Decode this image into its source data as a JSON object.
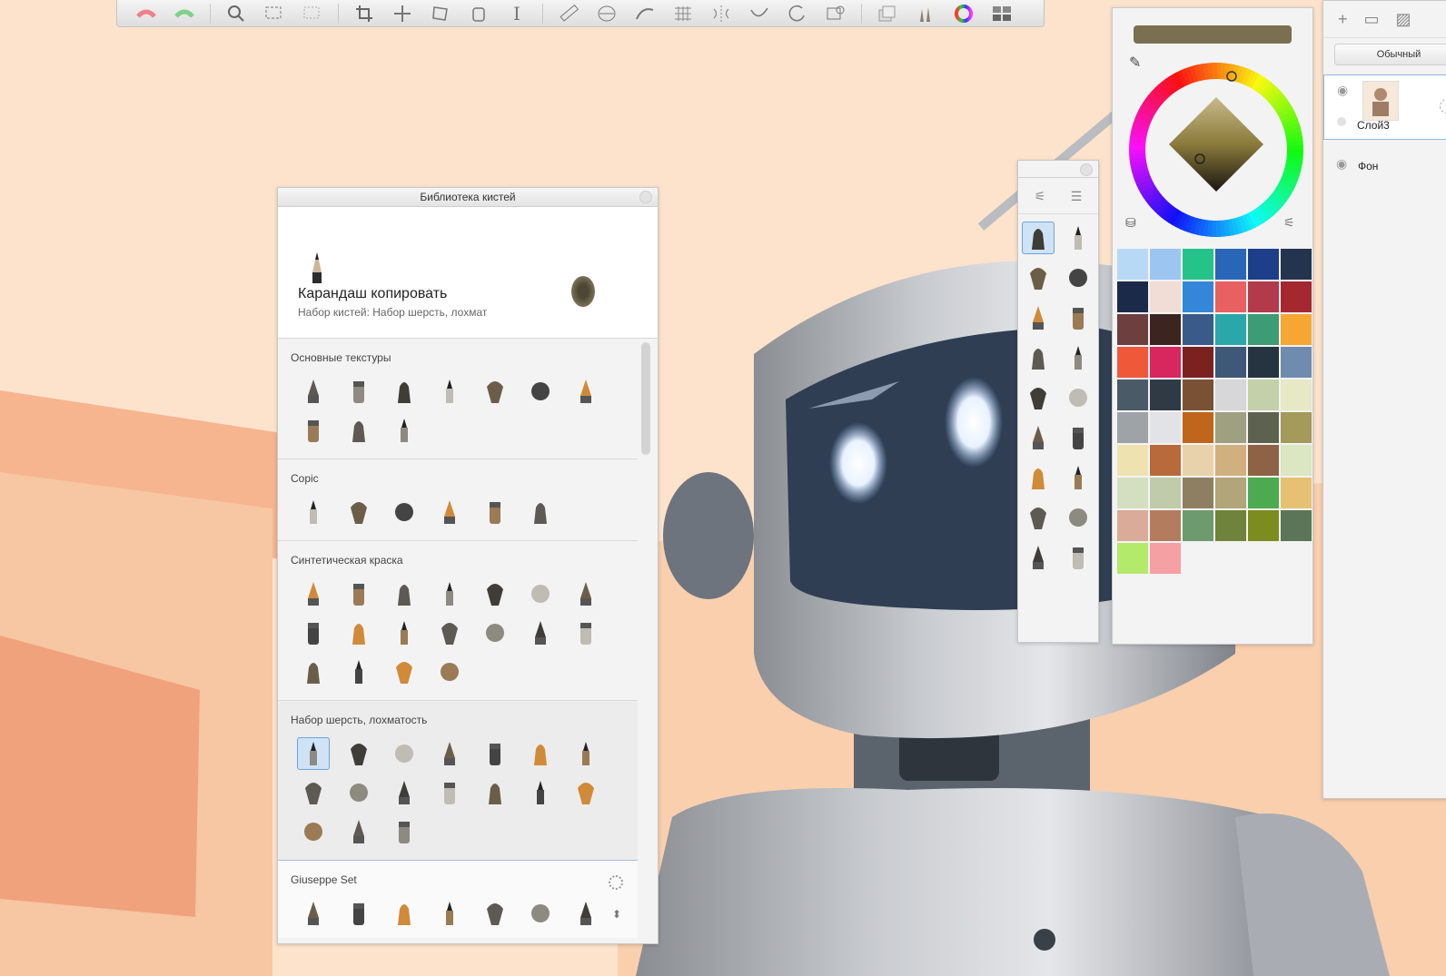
{
  "toolbar": {
    "icons": [
      "undo-icon",
      "redo-icon",
      "zoom-icon",
      "lasso-select-icon",
      "rect-select-icon",
      "crop-icon",
      "transform-icon",
      "distort-icon",
      "fill-icon",
      "text-icon",
      "ruler-icon",
      "ellipse-guide-icon",
      "french-curve-icon",
      "perspective-grid-icon",
      "symmetry-icon",
      "steady-stroke-icon",
      "predictive-stroke-icon",
      "shape-icon",
      "layers-icon",
      "brushes-icon",
      "color-wheel-icon",
      "copic-library-icon"
    ]
  },
  "brush_library": {
    "title": "Библиотека кистей",
    "current_brush": {
      "name": "Карандаш копировать",
      "set": "Набор кистей: Набор шерсть, лохмат"
    },
    "sections": [
      {
        "title": "Основные текстуры",
        "count": 10
      },
      {
        "title": "Copic",
        "count": 6
      },
      {
        "title": "Синтетическая краска",
        "count": 18
      },
      {
        "title": "Набор шерсть, лохматость",
        "count": 17
      },
      {
        "title": "Giuseppe Set",
        "count": 7
      }
    ]
  },
  "brush_shelf": {
    "tools": [
      "brush-settings-icon",
      "brush-library-icon"
    ],
    "count": 18
  },
  "color_panel": {
    "current_color": "#7a6f51",
    "palette": [
      "#b8d9f5",
      "#9cc6f1",
      "#25c28a",
      "#2a66b8",
      "#1d3f8a",
      "#24344f",
      "#1b2a48",
      "#f1ddd5",
      "#3487d8",
      "#e96060",
      "#b33a4b",
      "#a52830",
      "#6d3f3f",
      "#3c2420",
      "#3a5a8a",
      "#2aa7a8",
      "#3b9c75",
      "#f6a632",
      "#f0583a",
      "#d8265e",
      "#7b2221",
      "#3e5878",
      "#263340",
      "#6f8bb0",
      "#4a5b67",
      "#2f3a45",
      "#7a5135",
      "#d7d7d9",
      "#c3d0a8",
      "#e6e8c6",
      "#9ea3a8",
      "#e1e3e6",
      "#c0651c",
      "#9fa080",
      "#5d6150",
      "#a49a59",
      "#ede2b0",
      "#b96a3c",
      "#e8d2ab",
      "#cfb07e",
      "#8d6245",
      "#dbe6c2",
      "#d4dfc2",
      "#c0cbab",
      "#8f7f62",
      "#b3a57a",
      "#4caa51",
      "#e6c171",
      "#d9ab98",
      "#b47c5e",
      "#6d9a6f",
      "#70833a",
      "#7c8c1e",
      "#5c7458",
      "#b3ea6b",
      "#f5a0a3"
    ]
  },
  "layers": {
    "blend_mode": "Обычный",
    "items": [
      {
        "name": "Слой3",
        "selected": true
      },
      {
        "name": "Фон",
        "selected": false
      }
    ]
  }
}
